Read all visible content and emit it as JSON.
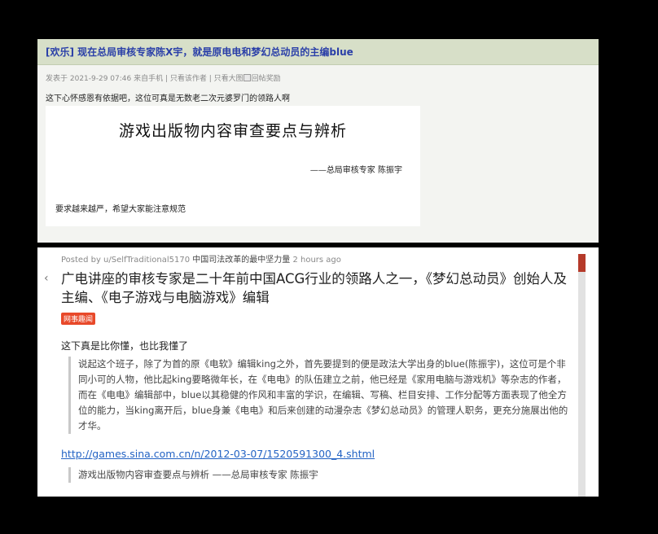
{
  "forum": {
    "title": "[欢乐] 现在总局审核专家陈X宇，就是原电电和梦幻总动员的主编blue",
    "meta": "发表于 2021-9-29 07:46  来自手机 | 只看该作者 | 只看大图",
    "meta_img_alt": "回帖奖励",
    "post_text": "这下心怀感恩有依据吧，这位可真是无数老二次元婆罗门的领路人啊",
    "doc": {
      "title": "游戏出版物内容审查要点与辨析",
      "author": "——总局审核专家 陈振宇",
      "note": "要求越来越严，希望大家能注意规范"
    }
  },
  "reddit": {
    "meta_posted": "Posted by u/SelfTraditional5170",
    "meta_hot": "中国司法改革的最中坚力量",
    "meta_time": "2 hours ago",
    "title": "广电讲座的审核专家是二十年前中国ACG行业的领路人之一，《梦幻总动员》创始人及主编、《电子游戏与电脑游戏》编辑",
    "flair": "网事趣闻",
    "body_line": "这下真是比你懂，也比我懂了",
    "quote": "说起这个班子，除了为首的原《电软》编辑king之外，首先要提到的便是政法大学出身的blue(陈振宇)，这位可是个非同小可的人物，他比起king要略微年长，在《电电》的队伍建立之前，他已经是《家用电脑与游戏机》等杂志的作者，而在《电电》编辑部中，blue以其稳健的作风和丰富的学识，在编辑、写稿、栏目安排、工作分配等方面表现了他全方位的能力，当king离开后，blue身兼《电电》和后来创建的动漫杂志《梦幻总动员》的管理人职务，更充分施展出他的才华。",
    "link": "http://games.sina.com.cn/n/2012-03-07/1520591300_4.shtml",
    "quote2": "游戏出版物内容审查要点与辨析 ——总局审核专家 陈振宇"
  },
  "colors": {
    "forum_title_bg": "#d7dfc8",
    "forum_title_text": "#2a3fa8",
    "flair_bg": "#e8492a",
    "link": "#2363c4",
    "scroll_thumb": "#b53a2a"
  }
}
